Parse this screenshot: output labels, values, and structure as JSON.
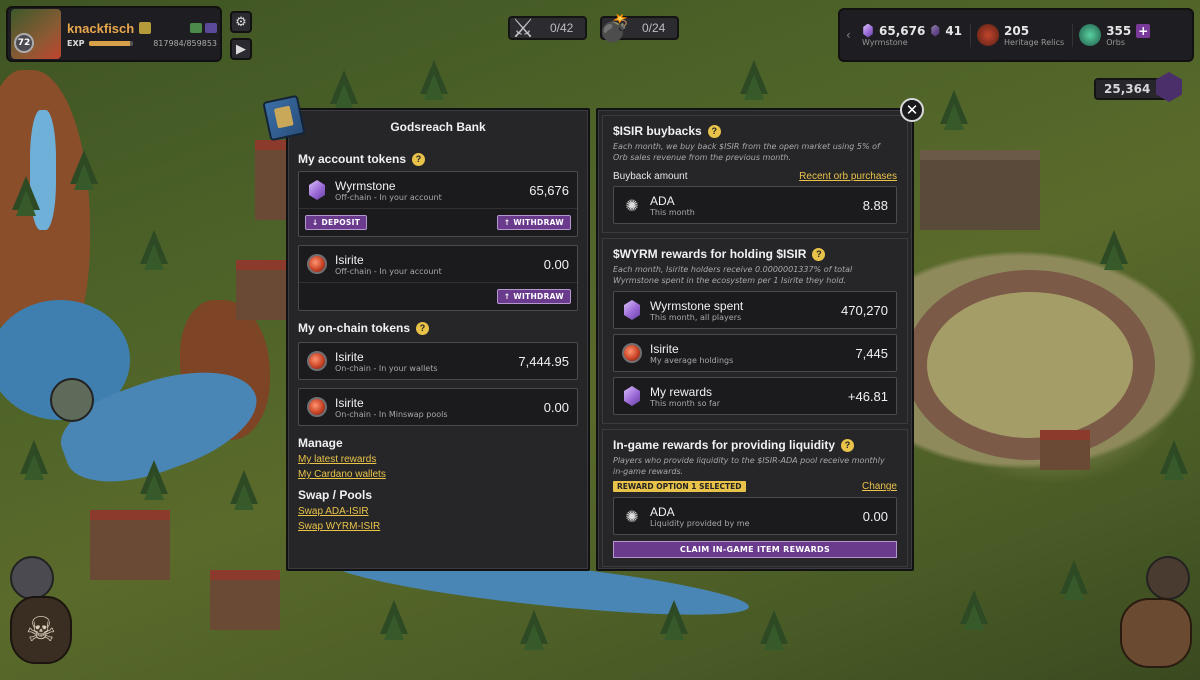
{
  "player": {
    "name": "knackfisch",
    "level": "72",
    "exp_label": "EXP",
    "exp_value": "817984/859853",
    "exp_fraction": 0.95
  },
  "counters": [
    {
      "icon": "crossed-swords-icon",
      "value": "0/42"
    },
    {
      "icon": "bomb-icon",
      "value": "0/24"
    }
  ],
  "resources": {
    "wyrmstone": {
      "value": "65,676",
      "extra": "41",
      "label": "Wyrmstone"
    },
    "heritage": {
      "value": "205",
      "label": "Heritage Relics"
    },
    "orbs": {
      "value": "355",
      "label": "Orbs",
      "plus": "+"
    }
  },
  "gem_count": "25,364",
  "bank": {
    "title": "Godsreach Bank",
    "close": "✕",
    "account_tokens": {
      "heading": "My account tokens",
      "help": "?",
      "wyrmstone": {
        "name": "Wyrmstone",
        "sub": "Off-chain - In your account",
        "value": "65,676",
        "deposit": "↓ DEPOSIT",
        "withdraw": "↑ WITHDRAW"
      },
      "isirite": {
        "name": "Isirite",
        "sub": "Off-chain - In your account",
        "value": "0.00",
        "withdraw": "↑ WITHDRAW"
      }
    },
    "onchain_tokens": {
      "heading": "My on-chain tokens",
      "help": "?",
      "wallets": {
        "name": "Isirite",
        "sub": "On-chain - In your wallets",
        "value": "7,444.95"
      },
      "pools": {
        "name": "Isirite",
        "sub": "On-chain - In Minswap pools",
        "value": "0.00"
      }
    },
    "manage": {
      "heading": "Manage",
      "links": [
        "My latest rewards",
        "My Cardano wallets"
      ]
    },
    "swap": {
      "heading": "Swap / Pools",
      "links": [
        "Swap ADA-ISIR",
        "Swap WYRM-ISIR"
      ]
    },
    "buybacks": {
      "heading": "$ISIR buybacks",
      "help": "?",
      "note": "Each month, we buy back $ISIR from the open market using 5% of Orb sales revenue from the previous month.",
      "amount_label": "Buyback amount",
      "link": "Recent orb purchases",
      "ada": {
        "name": "ADA",
        "sub": "This month",
        "value": "8.88"
      }
    },
    "wyrm_rewards": {
      "heading": "$WYRM rewards for holding $ISIR",
      "help": "?",
      "note": "Each month, Isirite holders receive 0.0000001337% of total Wyrmstone spent in the ecosystem per 1 Isirite they hold.",
      "spent": {
        "name": "Wyrmstone spent",
        "sub": "This month, all players",
        "value": "470,270"
      },
      "holdings": {
        "name": "Isirite",
        "sub": "My average holdings",
        "value": "7,445"
      },
      "mine": {
        "name": "My rewards",
        "sub": "This month so far",
        "value": "+46.81"
      }
    },
    "liquidity": {
      "heading": "In-game rewards for providing liquidity",
      "help": "?",
      "note": "Players who provide liquidity to the $ISIR-ADA pool receive monthly in-game rewards.",
      "badge": "REWARD OPTION 1 SELECTED",
      "change": "Change",
      "ada": {
        "name": "ADA",
        "sub": "Liquidity provided by me",
        "value": "0.00"
      },
      "claim": "CLAIM IN-GAME ITEM REWARDS"
    }
  },
  "colors": {
    "panel": "#262629",
    "accent_purple": "#6a3a8d",
    "accent_gold": "#e9c349",
    "player_name": "#e8a64d"
  }
}
